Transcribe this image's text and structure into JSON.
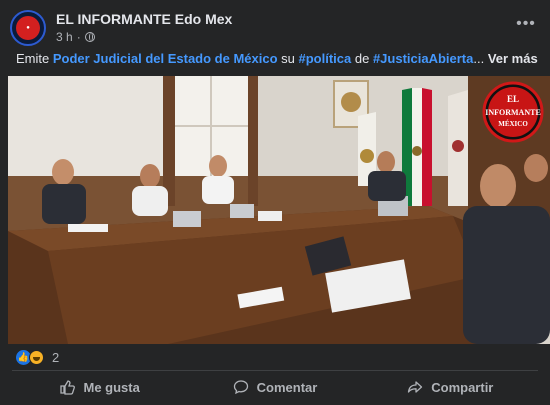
{
  "post": {
    "page_name": "EL INFORMANTE Edo Mex",
    "time": "3 h",
    "separator": "·",
    "more_icon": "ellipsis-icon",
    "text": {
      "part1": "Emite ",
      "link1": "Poder Judicial del Estado de México",
      "part2": " su ",
      "link2": "#política",
      "part3": " de ",
      "link3": "#JusticiaAbierta",
      "part4": "... ",
      "see_more": "Ver más"
    },
    "photo": {
      "logo_top": "EL",
      "logo_mid": "INFORMANTE",
      "logo_bot": "MÉXICO"
    }
  },
  "reactions": {
    "count": "2",
    "icons": [
      "like-icon",
      "haha-icon"
    ]
  },
  "actions": {
    "like": "Me gusta",
    "comment": "Comentar",
    "share": "Compartir"
  },
  "colors": {
    "background": "#242526",
    "link": "#4599ff",
    "text": "#e4e6eb",
    "muted": "#b0b3b8"
  }
}
